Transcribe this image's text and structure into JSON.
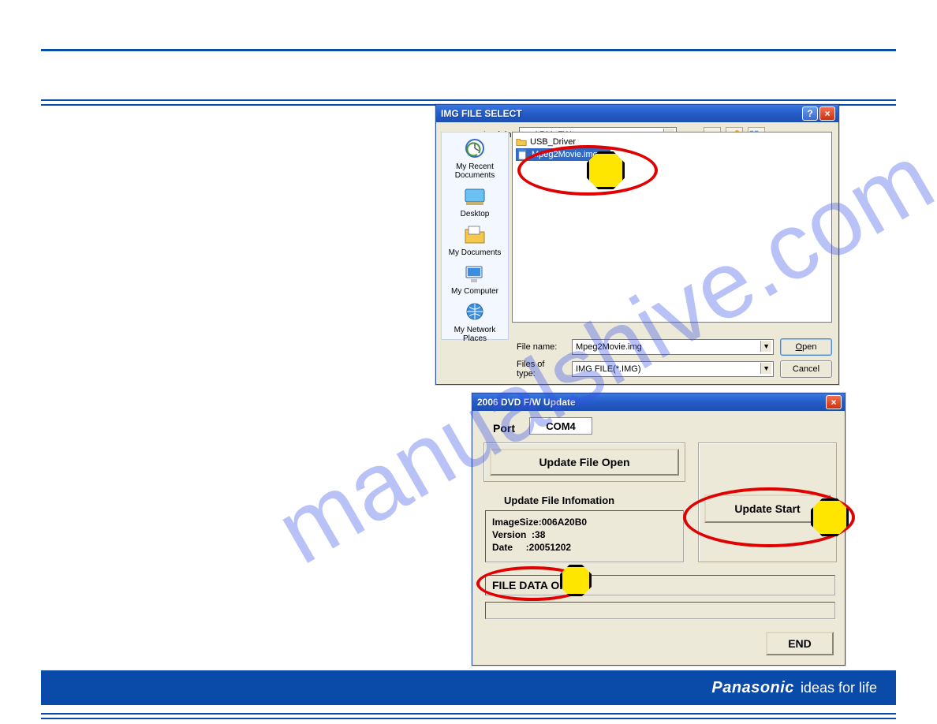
{
  "header": {
    "brand": "Panasonic",
    "slogan": "ideas for life"
  },
  "watermark": "manualshive.com",
  "file_dialog": {
    "title": "IMG FILE SELECT",
    "look_in_label": "Look in:",
    "look_in_value": "ARM_FW",
    "places": [
      {
        "label": "My Recent Documents"
      },
      {
        "label": "Desktop"
      },
      {
        "label": "My Documents"
      },
      {
        "label": "My Computer"
      },
      {
        "label": "My Network Places"
      }
    ],
    "items": [
      {
        "name": "USB_Driver",
        "type": "folder",
        "selected": false
      },
      {
        "name": "Mpeg2Movie.img",
        "type": "file",
        "selected": true
      }
    ],
    "file_name_label": "File name:",
    "file_name_value": "Mpeg2Movie.img",
    "files_of_type_label": "Files of type:",
    "files_of_type_value": "IMG FILE(*.IMG)",
    "open_label": "Open",
    "cancel_label": "Cancel"
  },
  "fw_update": {
    "title": "2006 DVD F/W Update",
    "port_label": "Port",
    "port_value": "COM4",
    "open_button": "Update File Open",
    "info_heading": "Update File Infomation",
    "info_text": "ImageSize:006A20B0\nVersion  :38\nDate     :20051202",
    "start_button": "Update Start",
    "status_text": "FILE DATA OK",
    "end_button": "END"
  }
}
